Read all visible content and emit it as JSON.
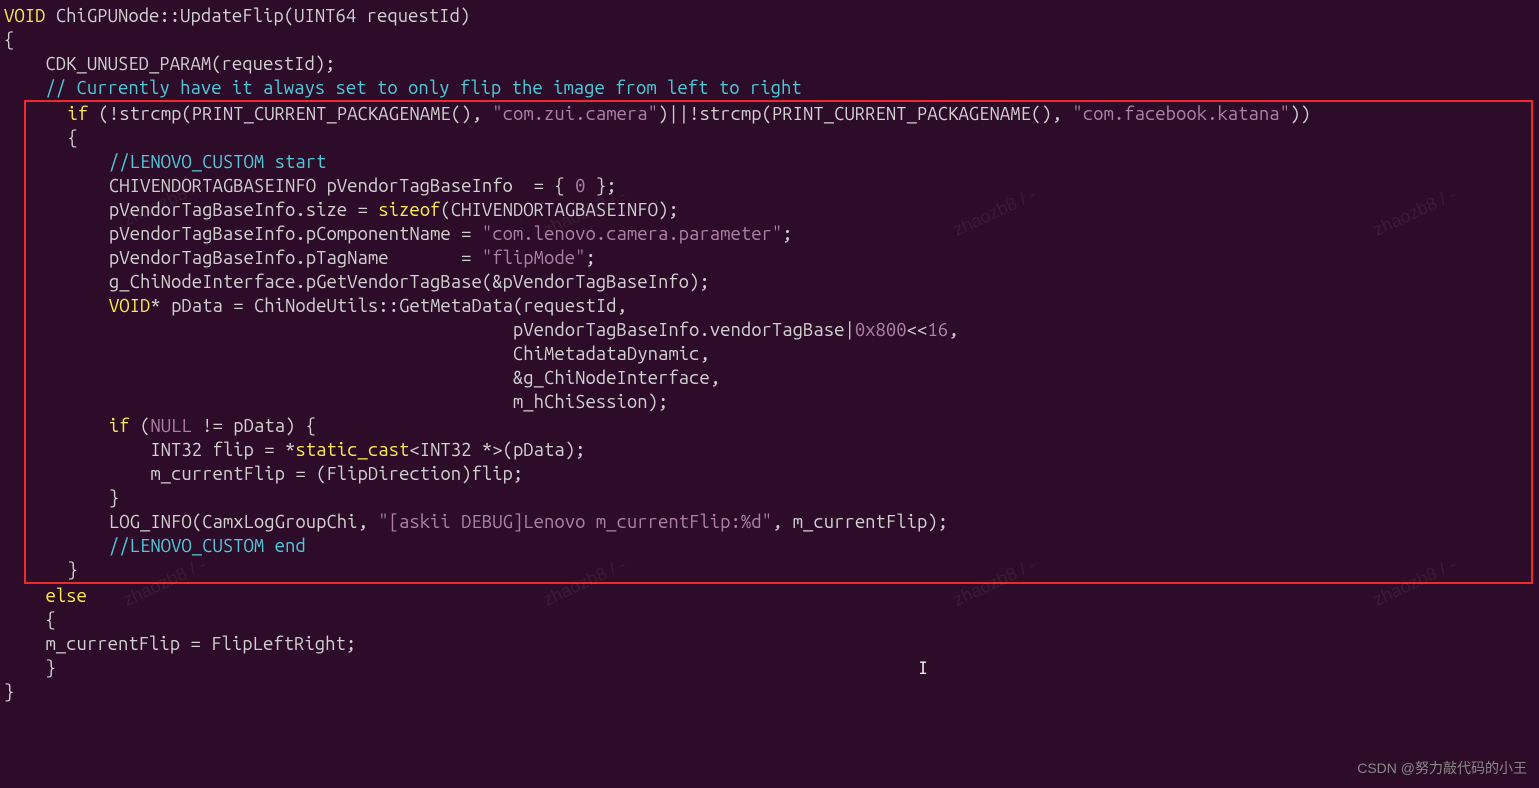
{
  "code": {
    "line1": {
      "keyword": "VOID",
      "text": " ChiGPUNode::UpdateFlip(UINT64 requestId)"
    },
    "line2": "{",
    "line3": "    CDK_UNUSED_PARAM(requestId);",
    "line4_comment": "    // Currently have it always set to only flip the image from left to right",
    "box": {
      "line5": {
        "indent": "    ",
        "if_kw": "if",
        "text1": " (!strcmp(PRINT_CURRENT_PACKAGENAME(), ",
        "str1": "\"com.zui.camera\"",
        "text2": ")||!strcmp(PRINT_CURRENT_PACKAGENAME(), ",
        "str2": "\"com.facebook.katana\"",
        "text3": "))"
      },
      "line6": "    {",
      "line7_comment": "        //LENOVO_CUSTOM start",
      "line8": {
        "text1": "        CHIVENDORTAGBASEINFO pVendorTagBaseInfo  = { ",
        "num": "0",
        "text2": " };"
      },
      "line9": {
        "text1": "        pVendorTagBaseInfo.size = ",
        "sizeof": "sizeof",
        "text2": "(CHIVENDORTAGBASEINFO);"
      },
      "line10": {
        "text1": "        pVendorTagBaseInfo.pComponentName = ",
        "str": "\"com.lenovo.camera.parameter\"",
        "text2": ";"
      },
      "line11": {
        "text1": "        pVendorTagBaseInfo.pTagName       = ",
        "str": "\"flipMode\"",
        "text2": ";"
      },
      "line12": "        g_ChiNodeInterface.pGetVendorTagBase(&pVendorTagBaseInfo);",
      "line13": "",
      "line14": {
        "indent": "        ",
        "void": "VOID",
        "text": "* pData = ChiNodeUtils::GetMetaData(requestId,"
      },
      "line15": {
        "text1": "                                               pVendorTagBaseInfo.vendorTagBase|",
        "num1": "0x800",
        "text2": "<<",
        "num2": "16",
        "text3": ","
      },
      "line16": "                                               ChiMetadataDynamic,",
      "line17": "                                               &g_ChiNodeInterface,",
      "line18": "                                               m_hChiSession);",
      "line19": {
        "indent": "        ",
        "if_kw": "if",
        "text1": " (",
        "null_kw": "NULL",
        "text2": " != pData) {"
      },
      "line20": {
        "text1": "            INT32 flip = *",
        "cast": "static_cast",
        "text2": "<INT32 *>(pData);"
      },
      "line21": "            m_currentFlip = (FlipDirection)flip;",
      "line22": "        }",
      "line23": {
        "text1": "        LOG_INFO(CamxLogGroupChi, ",
        "str": "\"[askii DEBUG]Lenovo m_currentFlip:%d\"",
        "text2": ", m_currentFlip);"
      },
      "line24_comment": "        //LENOVO_CUSTOM end",
      "line25": "    }"
    },
    "line26": {
      "indent": "    ",
      "else_kw": "else"
    },
    "line27": "    {",
    "line28": "    m_currentFlip = FlipLeftRight;",
    "line29": "    }",
    "line30": "",
    "line31": "}"
  },
  "watermark": "zhaozb8 / -",
  "footer": "CSDN @努力敲代码的小王",
  "cursor_char": "I"
}
